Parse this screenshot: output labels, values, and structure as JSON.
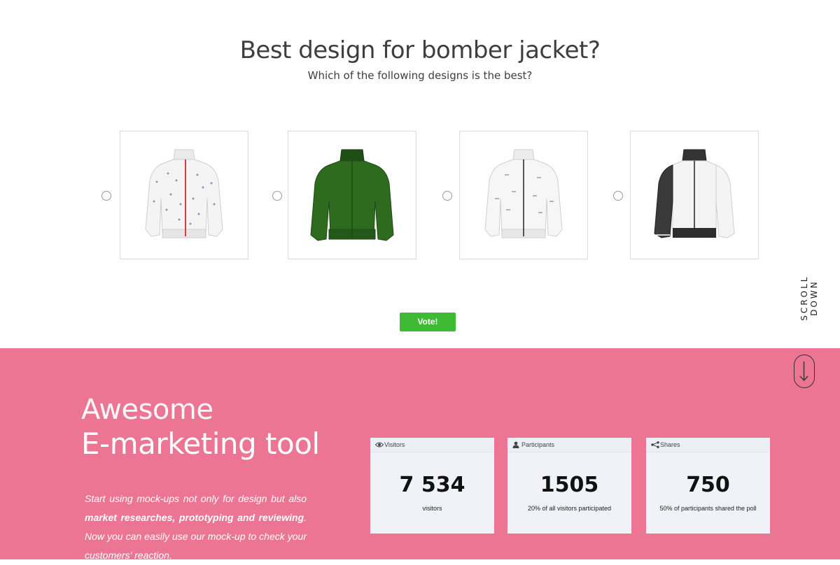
{
  "poll": {
    "title": "Best design for bomber jacket?",
    "subtitle": "Which of the following designs is the best?",
    "options": [
      {
        "name": "white dotted jacket with red zipper",
        "color": "#f4f4f4"
      },
      {
        "name": "green jacket",
        "color": "#2e6b1f"
      },
      {
        "name": "white patterned jacket",
        "color": "#f6f6f6"
      },
      {
        "name": "white jacket with black sleeves",
        "color": "#f4f4f4"
      }
    ],
    "vote_label": "Vote!"
  },
  "scroll": {
    "label": "SCROLL DOWN"
  },
  "promo": {
    "heading_line1": "Awesome",
    "heading_line2": "E-marketing tool",
    "paragraph_part1": "Start using mock-ups not only for design but also ",
    "paragraph_bold": "market researches, prototyping and reviewing",
    "paragraph_part2": ". Now you can easily use our mock-up to check your customers' reaction."
  },
  "stats": [
    {
      "label": "Visitors",
      "value": "7 534",
      "caption": "visitors",
      "icon": "eye-icon"
    },
    {
      "label": "Participants",
      "value": "1505",
      "caption": "20% of all visitors participated",
      "icon": "user-icon"
    },
    {
      "label": "Shares",
      "value": "750",
      "caption": "50% of participants shared the poll",
      "icon": "share-icon"
    }
  ],
  "colors": {
    "pink": "#ec7594",
    "vote_green": "#3fba35",
    "jacket_green": "#2e6b1f"
  }
}
